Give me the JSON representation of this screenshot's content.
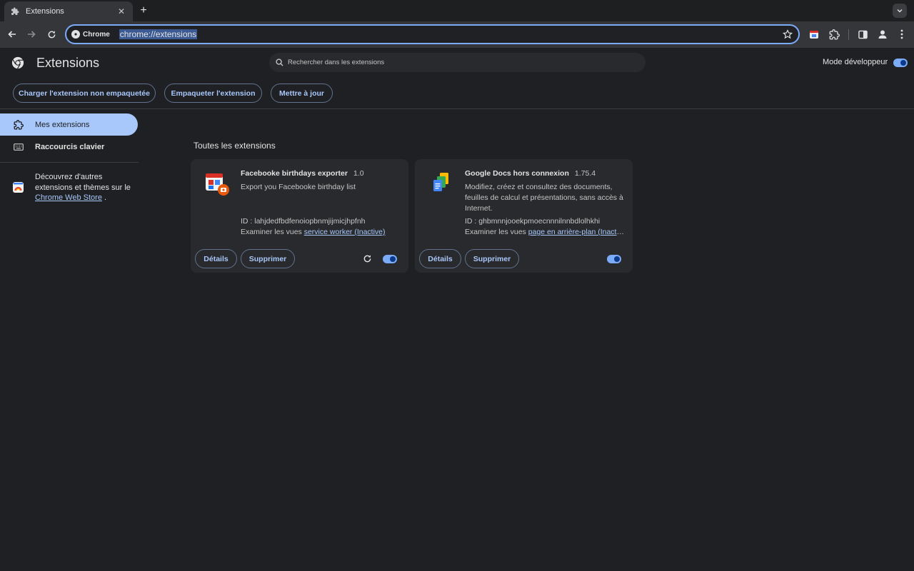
{
  "tab": {
    "title": "Extensions",
    "favicon": "puzzle-icon"
  },
  "toolbar": {
    "chip_label": "Chrome",
    "url": "chrome://extensions"
  },
  "header": {
    "title": "Extensions",
    "search_placeholder": "Rechercher dans les extensions",
    "dev_mode_label": "Mode développeur",
    "dev_mode_on": true,
    "buttons": {
      "load_unpacked": "Charger l'extension non empaquetée",
      "pack": "Empaqueter l'extension",
      "update": "Mettre à jour"
    }
  },
  "sidebar": {
    "items": [
      {
        "label": "Mes extensions",
        "icon": "extension-icon",
        "active": true
      },
      {
        "label": "Raccourcis clavier",
        "icon": "keyboard-icon",
        "active": false
      }
    ],
    "store_text": "Découvrez d'autres extensions et thèmes sur le",
    "store_link": "Chrome Web Store",
    "store_suffix": "."
  },
  "main": {
    "section_title": "Toutes les extensions",
    "extensions": [
      {
        "name": "Facebooke birthdays exporter",
        "version": "1.0",
        "description": "Export you Facebooke birthday list",
        "id": "ID : lahjdedfbdfenoiopbnmjijmicjhpfnh",
        "inspect_prefix": "Examiner les vues",
        "inspect_link": "service worker (Inactive)",
        "details_label": "Détails",
        "remove_label": "Supprimer",
        "enabled": true,
        "has_reload": true
      },
      {
        "name": "Google Docs hors connexion",
        "version": "1.75.4",
        "description": "Modifiez, créez et consultez des documents, feuilles de calcul et présentations, sans accès à Internet.",
        "id": "ID : ghbmnnjooekpmoecnnnilnnbdlolhkhi",
        "inspect_prefix": "Examiner les vues",
        "inspect_link": "page en arrière-plan (Inactive)",
        "details_label": "Détails",
        "remove_label": "Supprimer",
        "enabled": true,
        "has_reload": false
      }
    ]
  },
  "colors": {
    "accent": "#a8c7fa",
    "page_bg": "#1f2023",
    "card_bg": "#292a2d"
  }
}
